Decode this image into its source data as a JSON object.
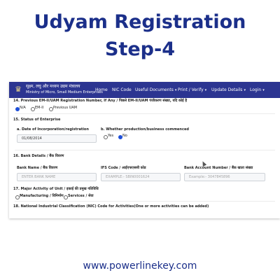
{
  "headline": {
    "line1": "Udyam  Registration",
    "line2": "Step-4"
  },
  "navbar": {
    "emblem": "♛",
    "ministry_hindi": "सूक्ष्म, लघु और मध्यम उद्यम मंत्रालय",
    "ministry_english": "Ministry of Micro, Small Medium Enterprises",
    "items": [
      "Home",
      "NIC Code",
      "Useful Documents",
      "Print / Verify",
      "Update Details",
      "Login"
    ],
    "caret": "▾"
  },
  "form": {
    "q14": {
      "label": "14. Previous EM-II/UAM Registration Number, If Any / पिछले EM-II/UAM पंजीकरण संख्या, यदि कोई है",
      "options": [
        "N/A",
        "EM-II",
        "Previous UAM"
      ],
      "selected": "N/A"
    },
    "q15": {
      "label": "15. Status of Enterprise",
      "incorporation_label": "a. Date of Incorporation/registration",
      "incorporation_value": "01/08/2014",
      "production_label": "b. Whether production/business commenced",
      "production_options": [
        "Yes",
        "No"
      ],
      "production_selected": "No"
    },
    "q16": {
      "label": "16. Bank Details / बैंक विवरण",
      "bank_name_label": "Bank Name / बैंक विवरण",
      "bank_name_placeholder": "ENTER BANK NAME",
      "ifs_label": "IFS Code / आईएफएससी कोड",
      "ifs_placeholder": "EXAMPLE:- SBIN0001624",
      "account_label": "Bank Account Number / बैंक खाता संख्या",
      "account_placeholder": "Example:- 3047845896"
    },
    "q17": {
      "label": "17. Major Activity of Unit / इकाई की प्रमुख गतिविधि",
      "options": [
        "Manufacturing / विनिर्माण",
        "Services / सेवा"
      ]
    },
    "q18": {
      "label": "18. National Industrial Classification (NIC) Code for Activities(One or more activities can be added)"
    }
  },
  "footer": {
    "url": "www.powerlinekey.com"
  },
  "colors": {
    "brand_blue": "#1b2f8a",
    "navbar_bg": "#2c3591",
    "radio_on": "#1e4fd8"
  }
}
